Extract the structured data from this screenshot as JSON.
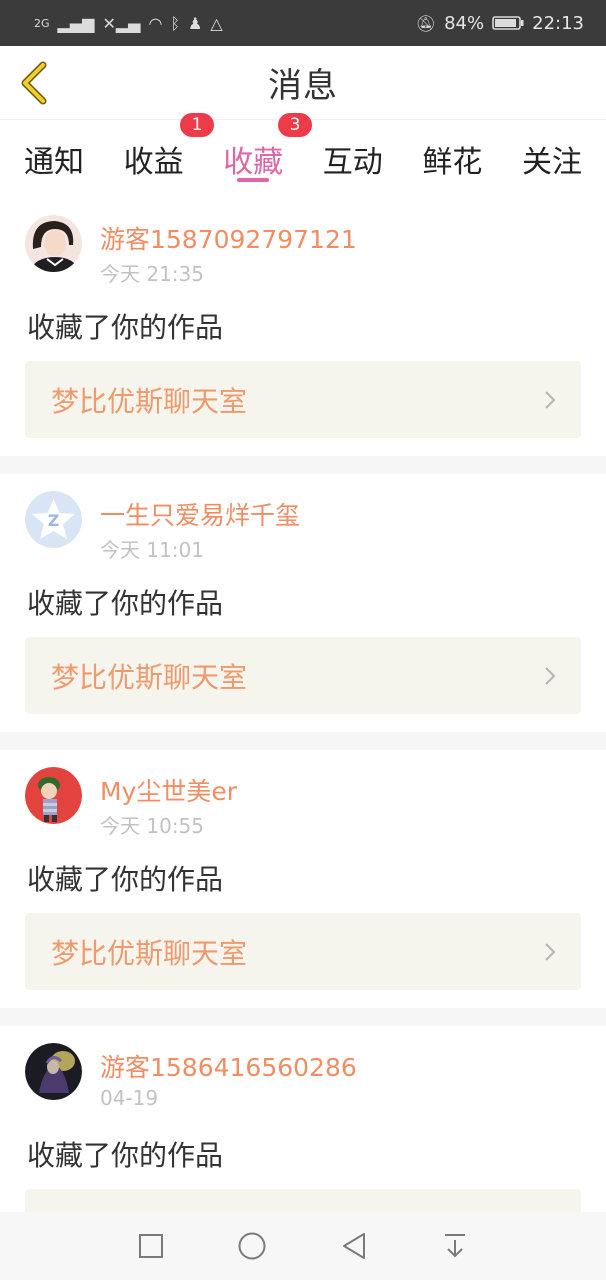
{
  "status_bar": {
    "left_text": "2G",
    "battery": "84%",
    "time": "22:13"
  },
  "header": {
    "title": "消息"
  },
  "tabs": [
    {
      "label": "通知"
    },
    {
      "label": "收益",
      "badge": "1"
    },
    {
      "label": "收藏",
      "badge": "3",
      "active": true
    },
    {
      "label": "互动"
    },
    {
      "label": "鲜花"
    },
    {
      "label": "关注"
    }
  ],
  "feed": [
    {
      "username": "游客1587092797121",
      "time": "今天 21:35",
      "action": "收藏了你的作品",
      "work": "梦比优斯聊天室"
    },
    {
      "username": "一生只爱易烊千玺",
      "time": "今天 11:01",
      "action": "收藏了你的作品",
      "work": "梦比优斯聊天室"
    },
    {
      "username": "My尘世美er",
      "time": "今天 10:55",
      "action": "收藏了你的作品",
      "work": "梦比优斯聊天室"
    },
    {
      "username": "游客1586416560286",
      "time": "04-19",
      "action": "收藏了你的作品",
      "work": ""
    }
  ],
  "colors": {
    "accent": "#e067a6",
    "username": "#f08d63",
    "badge": "#ee3b4a",
    "work_box_bg": "#f5f5ee"
  }
}
